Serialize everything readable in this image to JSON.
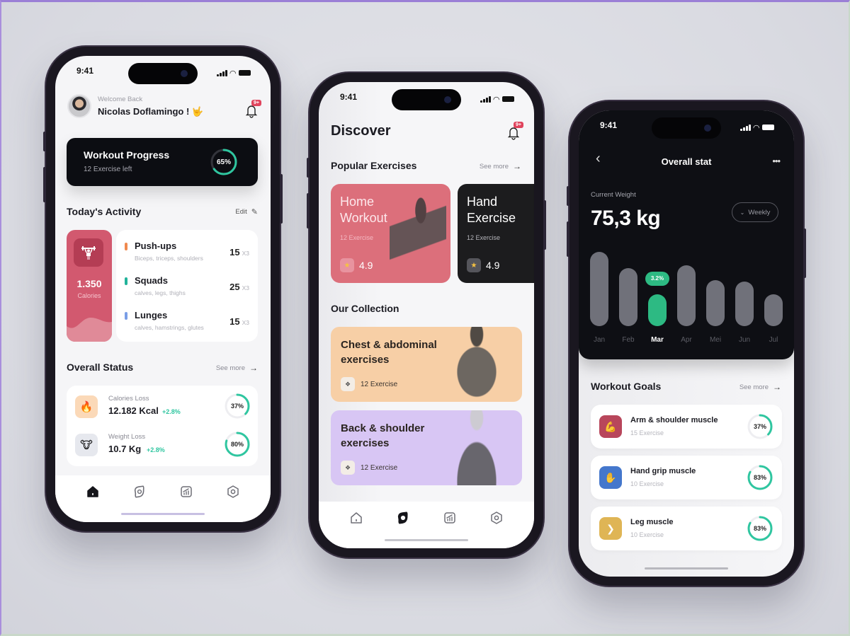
{
  "status_time": "9:41",
  "phone1": {
    "greeting": "Welcome Back",
    "user_name": "Nicolas Doflamingo ! 🤟",
    "notification_badge": "9+",
    "progress_card": {
      "title": "Workout Progress",
      "subtitle": "12 Exercise left",
      "percent_label": "65%",
      "percent": 65
    },
    "activity": {
      "title": "Today's Activity",
      "edit_label": "Edit",
      "calories_value": "1.350",
      "calories_label": "Calories",
      "items": [
        {
          "name": "Push-ups",
          "muscles": "Biceps, triceps, shoulders",
          "reps": "15",
          "sets": "X3",
          "color": "#f0894f"
        },
        {
          "name": "Squads",
          "muscles": "calves, legs, thighs",
          "reps": "25",
          "sets": "X3",
          "color": "#22b39a"
        },
        {
          "name": "Lunges",
          "muscles": "calves, hamstrings, glutes",
          "reps": "15",
          "sets": "X3",
          "color": "#7a9ee6"
        }
      ]
    },
    "overall": {
      "title": "Overall Status",
      "see_more": "See more",
      "items": [
        {
          "label": "Calories Loss",
          "value": "12.182 Kcal",
          "change": "+2.8%",
          "percent_label": "37%",
          "percent": 37,
          "icon": "fire-icon",
          "glyph": "🔥",
          "icon_bg": "#fbd9b8"
        },
        {
          "label": "Weight Loss",
          "value": "10.7 Kg",
          "change": "+2.8%",
          "percent_label": "80%",
          "percent": 80,
          "icon": "scale-icon",
          "glyph": "🐮",
          "icon_bg": "#e6e8ee"
        }
      ]
    },
    "nav": [
      "home",
      "discover",
      "stats",
      "settings"
    ],
    "active_nav": 0
  },
  "phone2": {
    "title": "Discover",
    "notification_badge": "9+",
    "popular": {
      "title": "Popular Exercises",
      "see_more": "See more",
      "cards": [
        {
          "title_line1": "Home",
          "title_line2": "Workout",
          "count": "12 Exercise",
          "rating": "4.9",
          "bg": "#dc6f7b"
        },
        {
          "title_line1": "Hand",
          "title_line2": "Exercise",
          "count": "12 Exercise",
          "rating": "4.9",
          "bg": "#1c1c1e"
        }
      ]
    },
    "collection": {
      "title": "Our Collection",
      "cards": [
        {
          "title_line1": "Chest & abdominal",
          "title_line2": "exercises",
          "count": "12 Exercise",
          "bg": "#f7cfa6"
        },
        {
          "title_line1": "Back & shoulder",
          "title_line2": "exercises",
          "count": "12 Exercise",
          "bg": "#d8c6f4"
        }
      ]
    },
    "nav": [
      "home",
      "discover",
      "stats",
      "settings"
    ],
    "active_nav": 1
  },
  "phone3": {
    "title": "Overall stat",
    "current_weight_label": "Current Weight",
    "current_weight": "75,3 kg",
    "period_selector": "Weekly",
    "bars": [
      {
        "month": "Jan",
        "value": 100,
        "active": false
      },
      {
        "month": "Feb",
        "value": 78,
        "active": false
      },
      {
        "month": "Mar",
        "value": 43,
        "active": true,
        "badge": "3.2%"
      },
      {
        "month": "Apr",
        "value": 82,
        "active": false
      },
      {
        "month": "Mei",
        "value": 62,
        "active": false
      },
      {
        "month": "Jun",
        "value": 60,
        "active": false
      },
      {
        "month": "Jul",
        "value": 43,
        "active": false
      }
    ],
    "goals": {
      "title": "Workout Goals",
      "see_more": "See more",
      "items": [
        {
          "name": "Arm & shoulder muscle",
          "count": "15 Exercise",
          "percent_label": "37%",
          "percent": 37,
          "icon": "arm-muscle-icon",
          "icon_bg": "#c2435a"
        },
        {
          "name": "Hand grip muscle",
          "count": "10 Exercise",
          "percent_label": "83%",
          "percent": 83,
          "icon": "hand-icon",
          "icon_bg": "#3f78d6"
        },
        {
          "name": "Leg muscle",
          "count": "10 Exercise",
          "percent_label": "83%",
          "percent": 83,
          "icon": "leg-icon",
          "icon_bg": "#e3b54a"
        }
      ]
    }
  },
  "colors": {
    "accent_green": "#2fc6a0",
    "bar_gray": "#70717a",
    "bar_green": "#2dba83",
    "dark_bg": "#0e0f14"
  }
}
